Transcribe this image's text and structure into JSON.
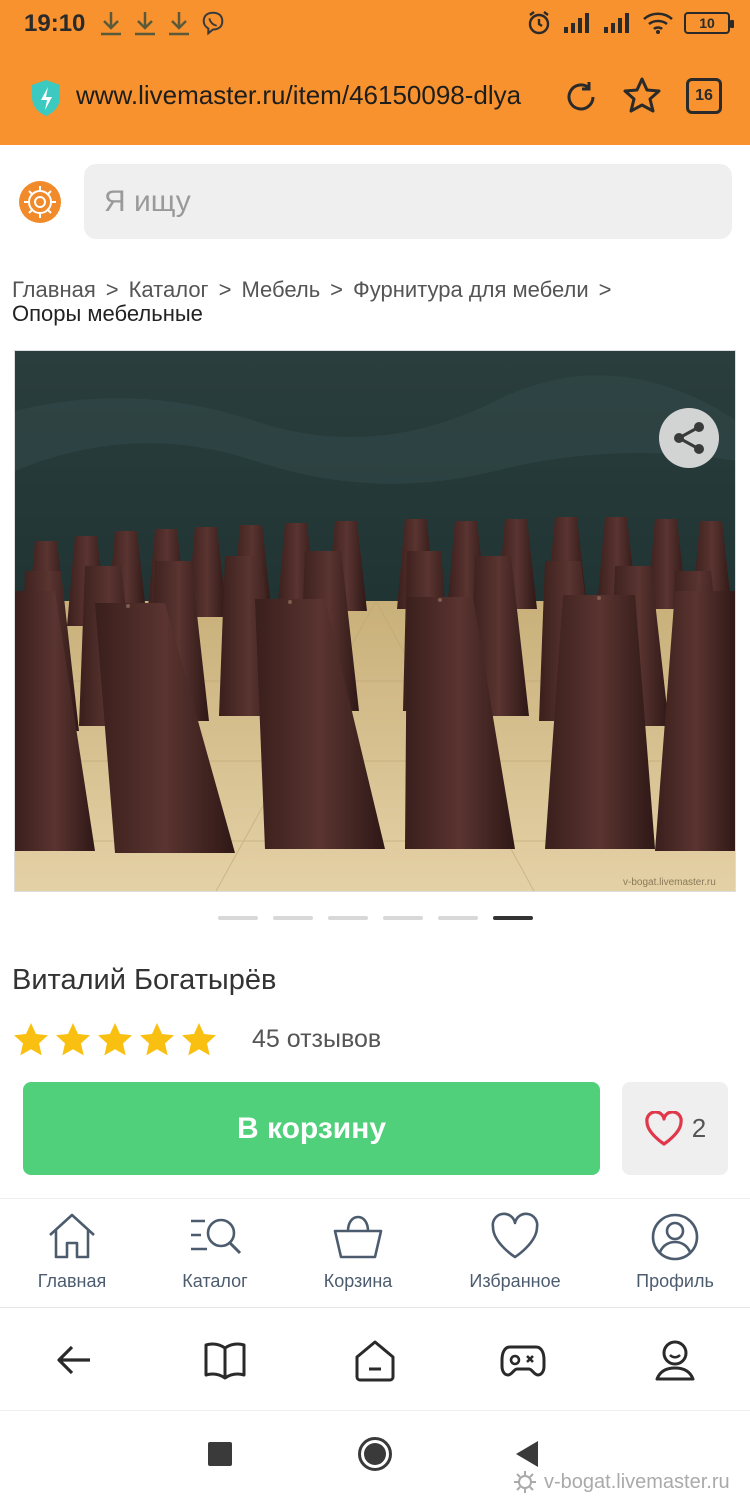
{
  "status_bar": {
    "time": "19:10",
    "battery": "10"
  },
  "browser": {
    "url": "www.livemaster.ru/item/46150098-dlya",
    "tab_count": "16"
  },
  "search": {
    "placeholder": "Я ищу"
  },
  "breadcrumb": {
    "items": [
      "Главная",
      "Каталог",
      "Мебель",
      "Фурнитура для мебели"
    ],
    "separator": ">",
    "current": "Опоры мебельные"
  },
  "gallery": {
    "total": 6,
    "active_index": 5,
    "photo_watermark": "v-bogat.livemaster.ru"
  },
  "product": {
    "seller": "Виталий Богатырёв",
    "rating": 5,
    "reviews": "45 отзывов",
    "cart_label": "В корзину",
    "favorites_count": "2"
  },
  "site_nav": [
    {
      "label": "Главная",
      "icon": "home-icon"
    },
    {
      "label": "Каталог",
      "icon": "catalog-search-icon"
    },
    {
      "label": "Корзина",
      "icon": "basket-icon"
    },
    {
      "label": "Избранное",
      "icon": "heart-icon"
    },
    {
      "label": "Профиль",
      "icon": "profile-icon"
    }
  ],
  "watermark": "v-bogat.livemaster.ru",
  "colors": {
    "browser_bar": "#F7922E",
    "cart_button": "#50D07A",
    "star": "#F9C011",
    "nav_icon": "#4C5C6E"
  }
}
